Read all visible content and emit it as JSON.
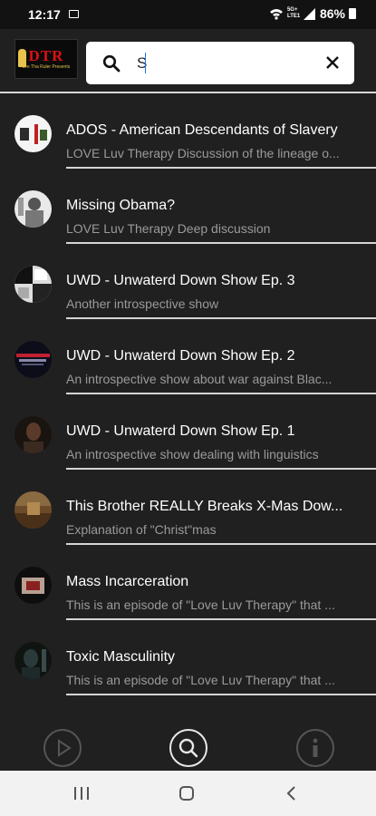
{
  "status": {
    "time": "12:17",
    "battery": "86%",
    "network": "5G+ LTE1"
  },
  "logo": {
    "text": "DTR",
    "subtitle": "Dre Tha Ruler Presents"
  },
  "search": {
    "value": "S",
    "icon": "search-icon",
    "clear_icon": "close-icon"
  },
  "episodes": [
    {
      "title": "ADOS - American Descendants of Slavery",
      "subtitle": "LOVE Luv Therapy Discussion of the lineage o..."
    },
    {
      "title": "Missing Obama?",
      "subtitle": "LOVE Luv Therapy Deep discussion"
    },
    {
      "title": "UWD - Unwaterd Down Show Ep. 3",
      "subtitle": "Another introspective show"
    },
    {
      "title": "UWD - Unwaterd Down Show Ep. 2",
      "subtitle": "An introspective show about war against Blac..."
    },
    {
      "title": "UWD - Unwaterd Down Show Ep. 1",
      "subtitle": "An introspective show dealing with linguistics"
    },
    {
      "title": "This Brother REALLY Breaks X-Mas Dow...",
      "subtitle": "Explanation of \"Christ\"mas"
    },
    {
      "title": "Mass Incarceration",
      "subtitle": "This is an episode of \"Love Luv Therapy\" that ..."
    },
    {
      "title": "Toxic Masculinity",
      "subtitle": "This is an episode of \"Love Luv Therapy\" that ..."
    }
  ],
  "bottom_nav": {
    "items": [
      "play-icon",
      "search-icon",
      "info-icon"
    ],
    "active": "search-icon"
  },
  "colors": {
    "background": "#202020",
    "divider": "#d5d5d5",
    "subtitle": "#9a9a9a"
  }
}
